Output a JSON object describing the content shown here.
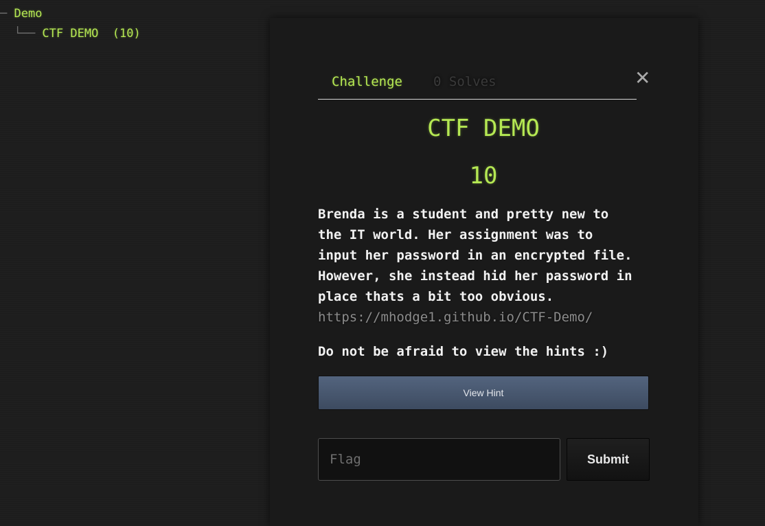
{
  "tree": {
    "category_prefix": "─ ",
    "category": "Demo",
    "child_connector": "  └── ",
    "challenge": "CTF DEMO  (10)"
  },
  "modal": {
    "close_symbol": "✕",
    "tabs": {
      "challenge": "Challenge",
      "solves": "0 Solves"
    },
    "challenge_name": "CTF DEMO",
    "challenge_value": "10",
    "description_lines": [
      "Brenda is a student and pretty new to",
      "the IT world. Her assignment was to",
      "input her password in an encrypted file.",
      "However, she instead hid her password in",
      "place thats a bit too obvious."
    ],
    "description_link": "https://mhodge1.github.io/CTF-Demo/",
    "hint_note": "Do not be afraid to view the hints :)",
    "view_hint_label": "View Hint",
    "flag_placeholder": "Flag",
    "submit_label": "Submit"
  },
  "colors": {
    "accent_green": "#b5e853",
    "background": "#1d1d1d",
    "panel": "#1a1a1a",
    "hint_button": "#4a5a72"
  }
}
